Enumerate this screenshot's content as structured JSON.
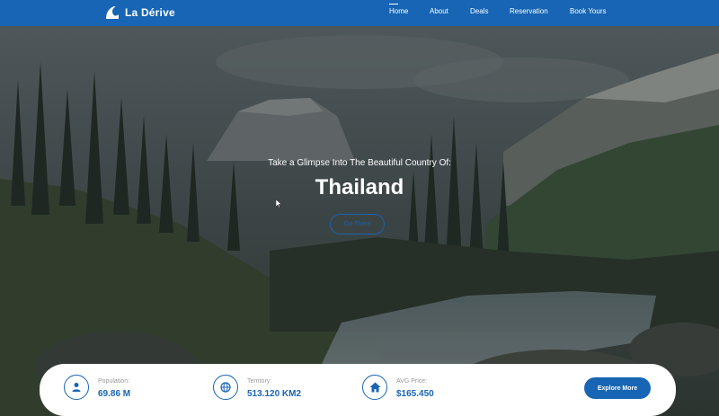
{
  "brand": {
    "name": "La Dérive"
  },
  "nav": {
    "items": [
      {
        "label": "Home",
        "active": true
      },
      {
        "label": "About",
        "active": false
      },
      {
        "label": "Deals",
        "active": false
      },
      {
        "label": "Reservation",
        "active": false
      },
      {
        "label": "Book Yours",
        "active": false
      }
    ]
  },
  "hero": {
    "subtitle": "Take a Glimpse Into The Beautiful Country Of:",
    "title": "Thailand",
    "cta_label": "Go There"
  },
  "stats": [
    {
      "icon": "user-icon",
      "label": "Population:",
      "value": "69.86 M"
    },
    {
      "icon": "globe-icon",
      "label": "Territory:",
      "value": "513.120 KM2"
    },
    {
      "icon": "home-icon",
      "label": "AVG Price:",
      "value": "$165.450"
    }
  ],
  "explore_label": "Explore More",
  "colors": {
    "primary": "#1765b4",
    "white": "#ffffff",
    "muted": "#9a9a9a"
  }
}
